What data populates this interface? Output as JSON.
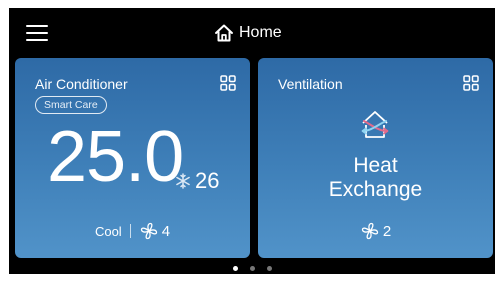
{
  "header": {
    "title": "Home",
    "menu_icon": "hamburger-menu-icon",
    "home_icon": "home-icon"
  },
  "cards": {
    "ac": {
      "title": "Air Conditioner",
      "badge": "Smart Care",
      "current_temp": "25.0",
      "target_temp": "26",
      "mode": "Cool",
      "fan_speed": "4",
      "icons": [
        "grid-icon",
        "snowflake-icon",
        "fan-icon"
      ]
    },
    "vent": {
      "title": "Ventilation",
      "mode_line1": "Heat",
      "mode_line2": "Exchange",
      "fan_speed": "2",
      "icons": [
        "grid-icon",
        "heat-exchange-icon",
        "fan-icon"
      ]
    }
  },
  "pagination": {
    "total": 3,
    "active": 1
  },
  "colors": {
    "background": "#000000",
    "card_top": "#2e6aa6",
    "card_bottom": "#5193c9",
    "accent_pink": "#e06a8c",
    "accent_blue": "#8fd4f2"
  }
}
